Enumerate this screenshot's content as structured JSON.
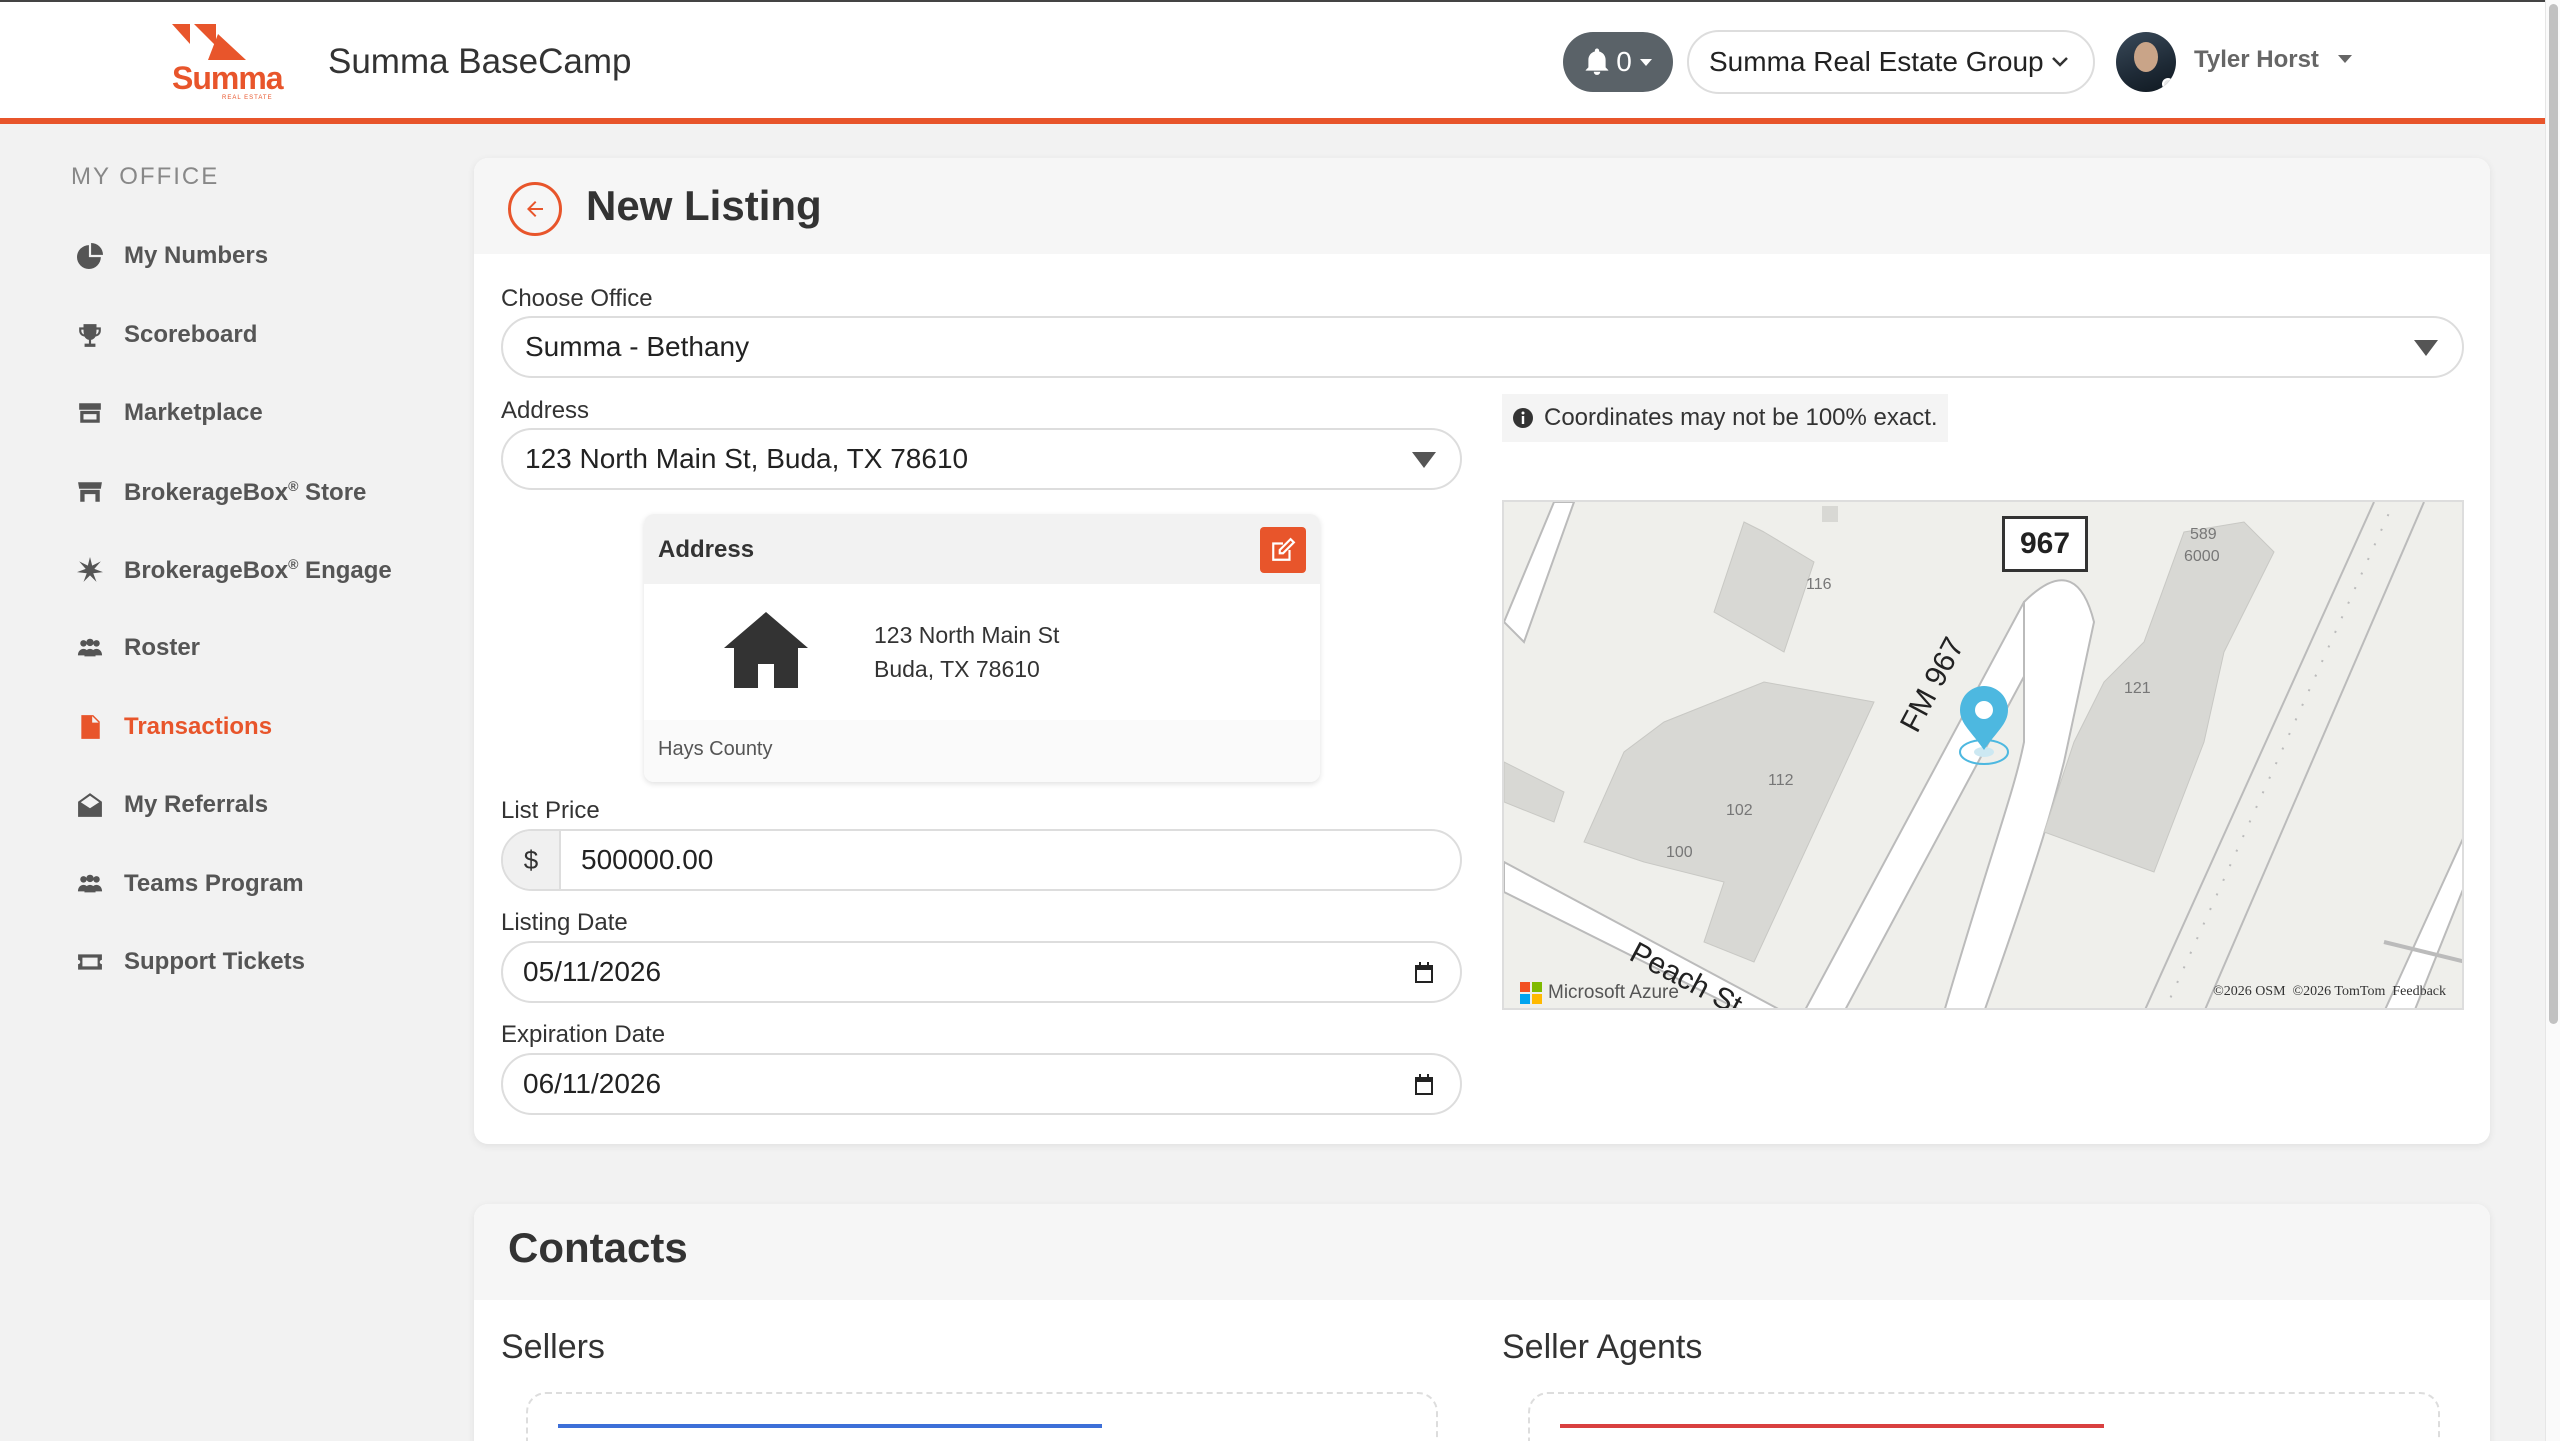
{
  "header": {
    "logo_text": "Summa",
    "logo_sub": "REAL ESTATE",
    "app_title": "Summa BaseCamp",
    "notifications_count": "0",
    "organization": "Summa Real Estate Group",
    "user_name": "Tyler Horst"
  },
  "sidebar": {
    "heading": "MY OFFICE",
    "items": [
      {
        "label": "My Numbers",
        "icon": "pie-chart-icon"
      },
      {
        "label": "Scoreboard",
        "icon": "trophy-icon"
      },
      {
        "label": "Marketplace",
        "icon": "store-icon"
      },
      {
        "label": "BrokerageBox",
        "sup": "®",
        "suffix": " Store",
        "icon": "shop-icon"
      },
      {
        "label": "BrokerageBox",
        "sup": "®",
        "suffix": " Engage",
        "icon": "burst-icon"
      },
      {
        "label": "Roster",
        "icon": "people-icon"
      },
      {
        "label": "Transactions",
        "icon": "file-icon",
        "active": true
      },
      {
        "label": "My Referrals",
        "icon": "envelope-open-icon"
      },
      {
        "label": "Teams Program",
        "icon": "people-icon"
      },
      {
        "label": "Support Tickets",
        "icon": "ticket-icon"
      }
    ]
  },
  "listing": {
    "title": "New Listing",
    "office_label": "Choose Office",
    "office_value": "Summa - Bethany",
    "address_label": "Address",
    "address_value": "123 North Main St, Buda, TX 78610",
    "address_card": {
      "title": "Address",
      "line1": "123 North Main St",
      "line2": "Buda, TX 78610",
      "county": "Hays County"
    },
    "coordinates_note": "Coordinates may not be 100% exact.",
    "list_price_label": "List Price",
    "currency_symbol": "$",
    "list_price_value": "500000.00",
    "listing_date_label": "Listing Date",
    "listing_date_value": "05/11/2026",
    "expiration_date_label": "Expiration Date",
    "expiration_date_value": "06/11/2026"
  },
  "map": {
    "highway_shield": "967",
    "road_label": "FM 967",
    "street_label": "Peach St",
    "building_labels": [
      "116",
      "589",
      "6000",
      "121",
      "112",
      "102",
      "100"
    ],
    "brand": "Microsoft Azure",
    "credit": "©2026 OSM  ©2026 TomTom  Feedback",
    "pin_color": "#4db8e0"
  },
  "contacts": {
    "title": "Contacts",
    "sellers_label": "Sellers",
    "seller_agents_label": "Seller Agents",
    "sellers_accent": "#3d6fd8",
    "seller_agents_accent": "#d94040"
  },
  "colors": {
    "accent": "#e8552b"
  }
}
